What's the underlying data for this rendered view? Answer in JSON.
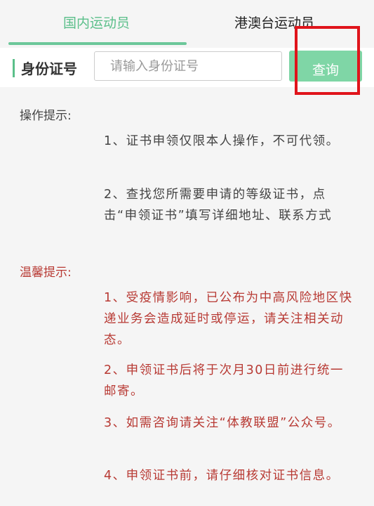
{
  "tabs": [
    {
      "label": "国内运动员"
    },
    {
      "label": "港澳台运动员"
    }
  ],
  "search": {
    "label": "身份证号",
    "placeholder": "请输入身份证号",
    "value": "",
    "button_label": "查询"
  },
  "operation_tips": {
    "title": "操作提示:",
    "items": [
      {
        "text": "1、证书申领仅限本人操作，不可代领。"
      },
      {
        "text": "2、查找您所需要申请的等级证书，点击“申领证书”填写详细地址、联系方式"
      }
    ]
  },
  "warm_tips": {
    "title": "温馨提示:",
    "items": [
      {
        "text": "1、受疫情影响，已公布为中高风险地区快递业务会造成延时或停运，请关注相关动态。"
      },
      {
        "text": "2、申领证书后将于次月30日前进行统一邮寄。"
      },
      {
        "text": "3、如需咨询请关注“体教联盟”公众号。"
      },
      {
        "text": "4、申领证书前，请仔细核对证书信息。"
      }
    ]
  },
  "colors": {
    "accent": "#5bbf8a",
    "button": "#7fd6a6",
    "warning_text": "#b83a34",
    "highlight": "#e0141b"
  }
}
